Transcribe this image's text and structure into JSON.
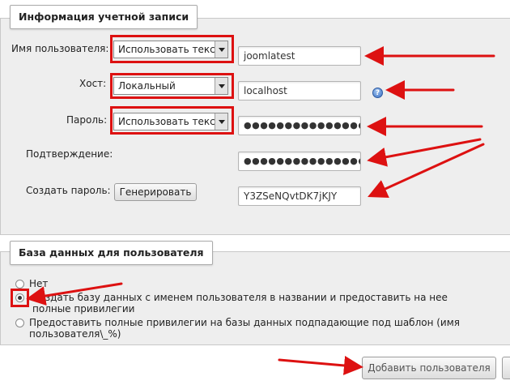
{
  "account": {
    "legend": "Информация учетной записи",
    "username": {
      "label": "Имя пользователя:",
      "select_value": "Использовать текс",
      "value": "joomlatest"
    },
    "host": {
      "label": "Хост:",
      "select_value": "Локальный",
      "value": "localhost"
    },
    "password": {
      "label": "Пароль:",
      "select_value": "Использовать текс",
      "value": "●●●●●●●●●●●●●●●●"
    },
    "confirm": {
      "label": "Подтверждение:",
      "value": "●●●●●●●●●●●●●●●●"
    },
    "generate": {
      "label": "Создать пароль:",
      "button": "Генерировать",
      "value": "Y3ZSeNQvtDK7jKJY"
    }
  },
  "db": {
    "legend": "База данных для пользователя",
    "options": [
      {
        "label": "Нет",
        "checked": false
      },
      {
        "label": "Создать базу данных с именем пользователя в названии и предоставить на нее полные привилегии",
        "checked": true
      },
      {
        "label": "Предоставить полные привилегии на базы данных подпадающие под шаблон (имя пользователя\\_%)",
        "checked": false
      }
    ]
  },
  "footer": {
    "add_user_button": "Добавить пользователя"
  },
  "icons": {
    "help": "help-icon",
    "select_arrow": "chevron-down-icon",
    "annotation": "arrow-icon"
  },
  "colors": {
    "annotation_red": "#dd1111",
    "fieldset_bg": "#eeeeee"
  }
}
